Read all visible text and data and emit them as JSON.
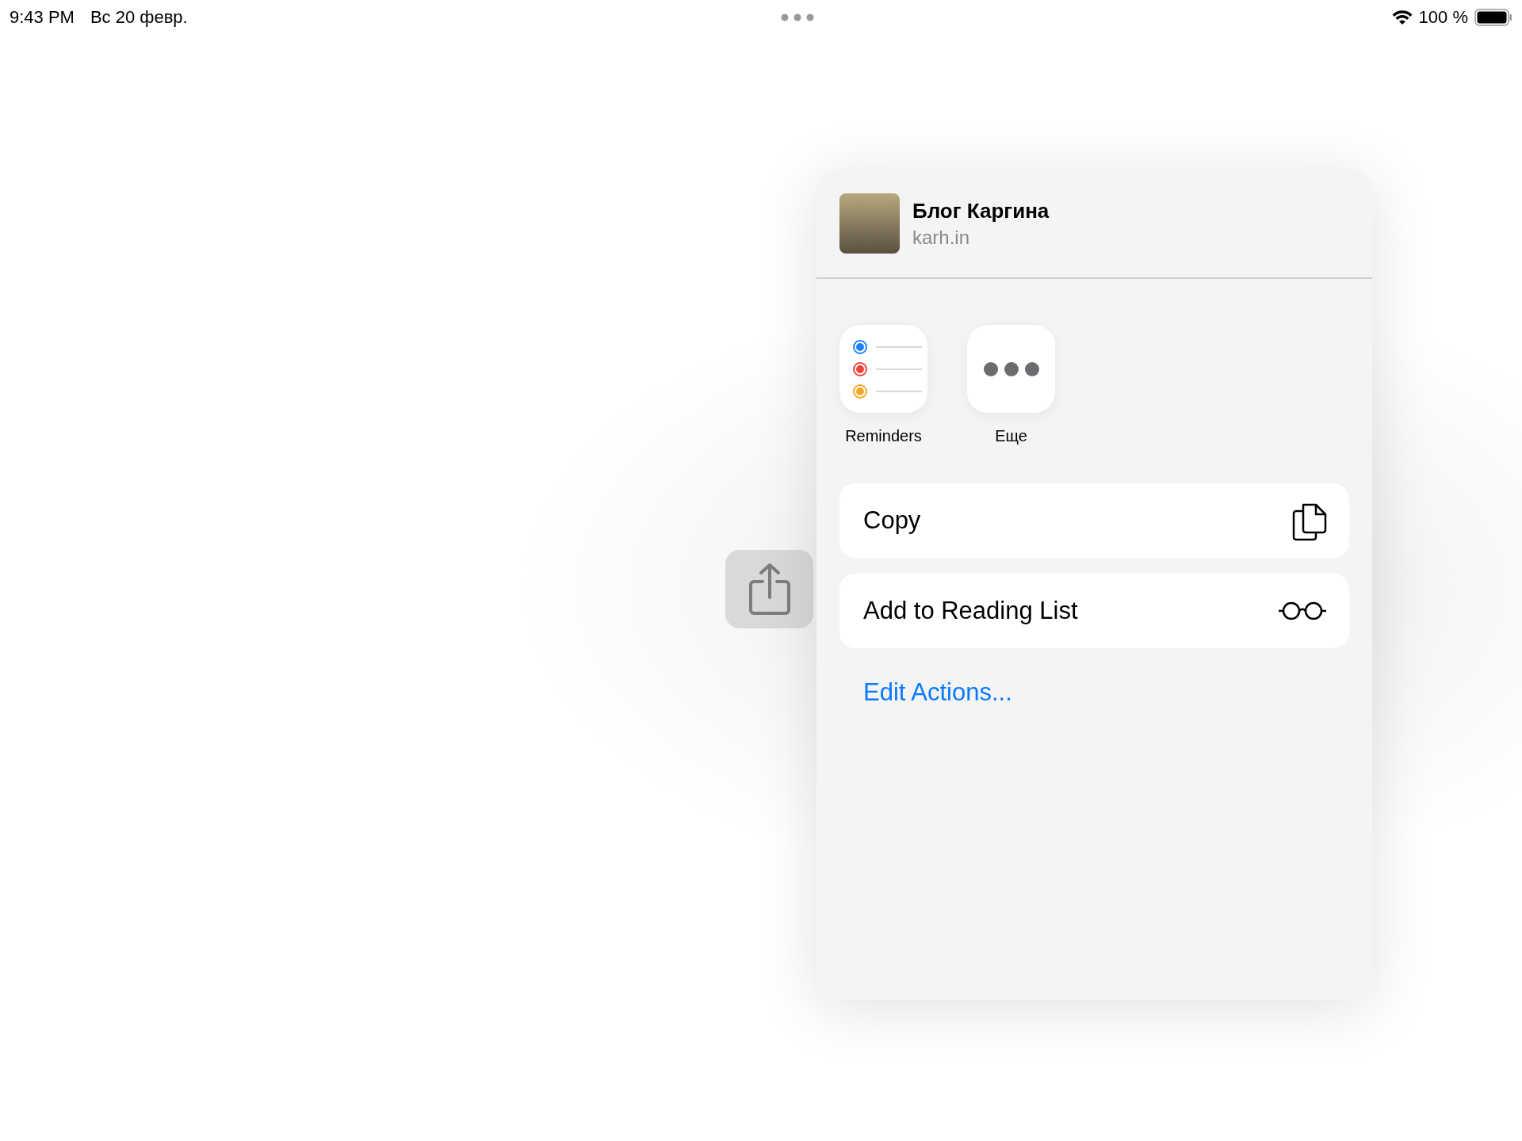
{
  "status_bar": {
    "time": "9:43 PM",
    "date": "Вс 20 февр.",
    "battery": "100 %"
  },
  "share_sheet": {
    "header": {
      "title": "Блог Каргина",
      "subtitle": "karh.in"
    },
    "apps": [
      {
        "kind": "reminders",
        "label": "Reminders"
      },
      {
        "kind": "more",
        "label": "Еще"
      }
    ],
    "actions": [
      {
        "kind": "copy",
        "label": "Copy"
      },
      {
        "kind": "reading-list",
        "label": "Add to Reading List"
      }
    ],
    "edit_link": "Edit Actions..."
  }
}
